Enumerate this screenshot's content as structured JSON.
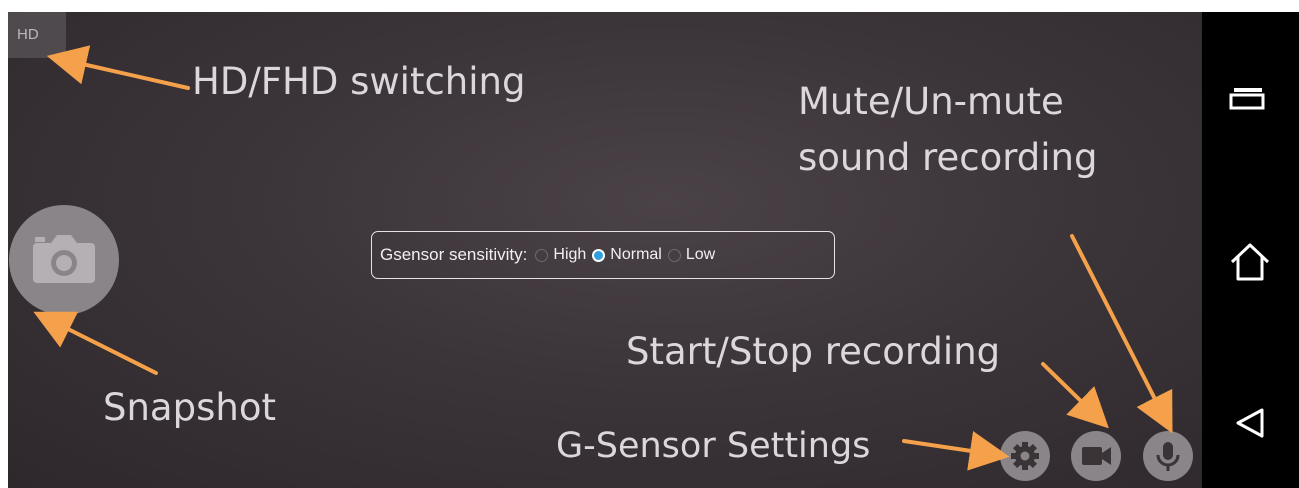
{
  "hd_badge": "HD",
  "gsensor": {
    "label": "Gsensor sensitivity:",
    "options": [
      {
        "label": "High",
        "checked": false
      },
      {
        "label": "Normal",
        "checked": true
      },
      {
        "label": "Low",
        "checked": false
      }
    ]
  },
  "annotations": {
    "hd_switch": "HD/FHD switching",
    "mute_line1": "Mute/Un-mute",
    "mute_line2": "sound recording",
    "start_stop": "Start/Stop recording",
    "snapshot": "Snapshot",
    "gsensor_settings": "G-Sensor Settings"
  },
  "icons": {
    "snapshot": "camera-icon",
    "settings": "gear-icon",
    "record": "video-camera-icon",
    "mic": "microphone-icon",
    "nav_recent": "recent-apps-icon",
    "nav_home": "home-icon",
    "nav_back": "back-icon"
  },
  "colors": {
    "arrow": "#f5a04a",
    "selected_radio": "#2f9fe0",
    "button_gray": "#8a8589"
  }
}
